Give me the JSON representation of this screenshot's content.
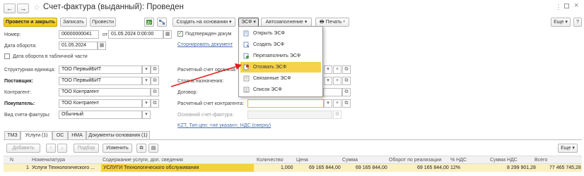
{
  "header": {
    "title": "Счет-фактура (выданный): Проведен",
    "more_label": "⋮",
    "close_label": "×"
  },
  "toolbar": {
    "post_close_label": "Провести и закрыть",
    "save_label": "Записать",
    "post_label": "Провести",
    "create_based_label": "Создать на основании ▾",
    "esf_label": "ЭСФ ▾",
    "autofill_label": "Автозаполнение ▾",
    "print_label": "Печать ▾",
    "more_label": "Еще ▾",
    "help_label": "?"
  },
  "form": {
    "number_label": "Номер:",
    "number_value": "00000000041",
    "from_label": "от:",
    "date_value": "01.05.2024  0:00:00",
    "turnover_date_label": "Дата оборота:",
    "turnover_date_value": "01.05.2024",
    "turnover_in_table_label": "Дата оборота в табличной части",
    "confirmed_label": "Подтвержден докум",
    "reverse_link": "Сторнировать документ",
    "unit_label": "Структурная единица:",
    "unit_value": "ТОО ПервыйБИТ",
    "supplier_label": "Поставщик:",
    "supplier_value": "ТОО ПервыйБИТ",
    "counterparty_label": "Контрагент:",
    "counterparty_value": "ТОО Контрагент",
    "buyer_label": "Покупатель:",
    "buyer_value": "ТОО Контрагент",
    "invoice_type_label": "Вид счета-фактуры:",
    "invoice_type_value": "Обычный",
    "org_account_label": "Расчетный счет организа",
    "country_label": "Страна назначения:",
    "contract_label": "Договор:",
    "counterparty_account_label": "Расчетный счет контрагента:",
    "base_invoice_label": "Основной счет-фактура:",
    "price_link": "KZT, Тип цен: <не указан>, НДС (сверху)"
  },
  "esf_menu": {
    "items": [
      {
        "label": "Открыть ЭСФ",
        "icon": "open-doc-icon"
      },
      {
        "label": "Создать ЭСФ",
        "icon": "create-doc-icon"
      },
      {
        "label": "Перезаполнить ЭСФ",
        "icon": "refill-icon"
      },
      {
        "label": "Отозвать ЭСФ",
        "icon": "revoke-icon",
        "selected": true
      },
      {
        "label": "Связанные ЭСФ",
        "icon": "related-icon"
      },
      {
        "label": "Список ЭСФ",
        "icon": "list-icon"
      }
    ]
  },
  "tabs": [
    {
      "label": "ТМЗ"
    },
    {
      "label": "Услуги (1)",
      "active": true
    },
    {
      "label": "ОС"
    },
    {
      "label": "НМА"
    },
    {
      "label": "Документы-основания (1)"
    }
  ],
  "table_toolbar": {
    "add_label": "Добавить",
    "pick_label": "Подбор",
    "change_label": "Изменить",
    "more_label": "Еще ▾"
  },
  "table": {
    "columns": [
      "N",
      "Номенклатура",
      "Содержание услуги, доп. сведения",
      "Количество",
      "Цена",
      "Сумма",
      "Оборот по реализации",
      "% НДС",
      "Сумма НДС",
      "Всего"
    ],
    "rows": [
      [
        "1",
        "Услуги Технологического ...",
        "УСЛУГИ Технологического обслуживания",
        "1,000",
        "69 165 844,00",
        "69 165 844,00",
        "69 165 844,00",
        "12%",
        "8 299 901,28",
        "77 465 745,28"
      ]
    ]
  },
  "colors": {
    "accent_yellow": "#f5c700",
    "selection": "#f6d24a",
    "arrow": "#e02020",
    "link": "#4a6ea9"
  }
}
